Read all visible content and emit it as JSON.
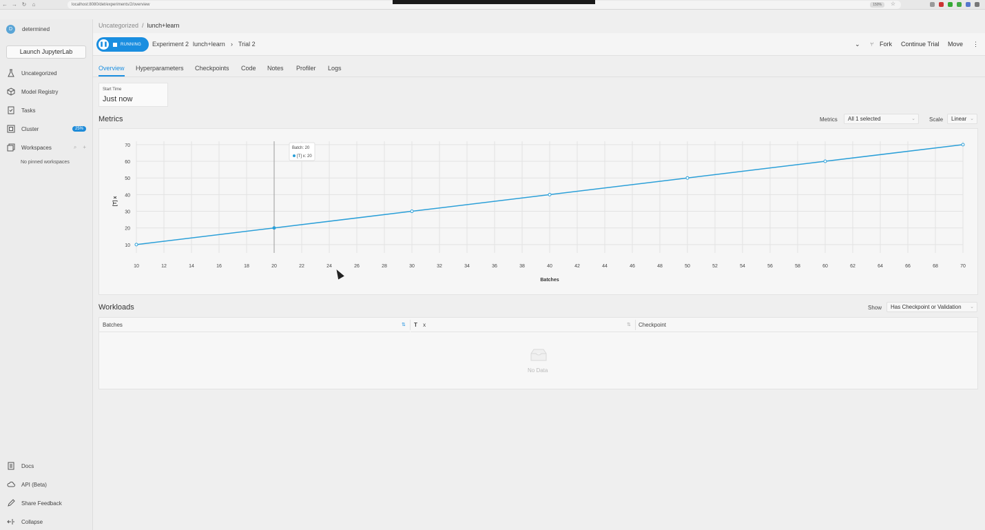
{
  "browser": {
    "url": "localhost:8080/det/experiments/2/overview",
    "zoom": "150%"
  },
  "sidebar": {
    "brand_initial": "D",
    "brand_name": "determined",
    "launch_button": "Launch JupyterLab",
    "items": [
      {
        "label": "Uncategorized",
        "icon": "flask-icon"
      },
      {
        "label": "Model Registry",
        "icon": "cube-icon"
      },
      {
        "label": "Tasks",
        "icon": "tasks-icon"
      },
      {
        "label": "Cluster",
        "icon": "cluster-icon",
        "badge": "25%"
      },
      {
        "label": "Workspaces",
        "icon": "workspaces-icon"
      }
    ],
    "no_pinned": "No pinned workspaces",
    "bottom_items": [
      {
        "label": "Docs",
        "icon": "docs-icon"
      },
      {
        "label": "API (Beta)",
        "icon": "cloud-icon"
      },
      {
        "label": "Share Feedback",
        "icon": "pencil-icon"
      },
      {
        "label": "Collapse",
        "icon": "collapse-icon"
      }
    ]
  },
  "breadcrumb": {
    "parent": "Uncategorized",
    "separator": "/",
    "current": "lunch+learn"
  },
  "header": {
    "status": "RUNNING",
    "experiment": "Experiment 2",
    "experiment_name": "lunch+learn",
    "trial_separator": "›",
    "trial": "Trial 2",
    "fork": "Fork",
    "continue_trial": "Continue Trial",
    "move": "Move"
  },
  "tabs": [
    "Overview",
    "Hyperparameters",
    "Checkpoints",
    "Code",
    "Notes",
    "Profiler",
    "Logs"
  ],
  "start_time": {
    "label": "Start Time",
    "value": "Just now"
  },
  "metrics": {
    "title": "Metrics",
    "metrics_label": "Metrics",
    "metrics_value": "All 1 selected",
    "scale_label": "Scale",
    "scale_value": "Linear"
  },
  "chart_data": {
    "type": "line",
    "xlabel": "Batches",
    "ylabel": "[T] x",
    "x": [
      10,
      20,
      30,
      40,
      50,
      60,
      70
    ],
    "series": [
      {
        "name": "[T] x",
        "values": [
          10,
          20,
          30,
          40,
          50,
          60,
          70
        ],
        "color": "#2a9fd8"
      }
    ],
    "xlim": [
      10,
      70
    ],
    "ylim": [
      5,
      72
    ],
    "xticks": [
      10,
      12,
      14,
      16,
      18,
      20,
      22,
      24,
      26,
      28,
      30,
      32,
      34,
      36,
      38,
      40,
      42,
      44,
      46,
      48,
      50,
      52,
      54,
      56,
      58,
      60,
      62,
      64,
      66,
      68,
      70
    ],
    "yticks": [
      10,
      20,
      30,
      40,
      50,
      60,
      70
    ],
    "grid": true,
    "tooltip": {
      "title": "Batch: 20",
      "entry": "[T] x: 20",
      "x": 20
    }
  },
  "workloads": {
    "title": "Workloads",
    "show_label": "Show",
    "show_value": "Has Checkpoint or Validation",
    "columns": [
      "Batches",
      "x",
      "Checkpoint"
    ],
    "empty_text": "No Data"
  }
}
